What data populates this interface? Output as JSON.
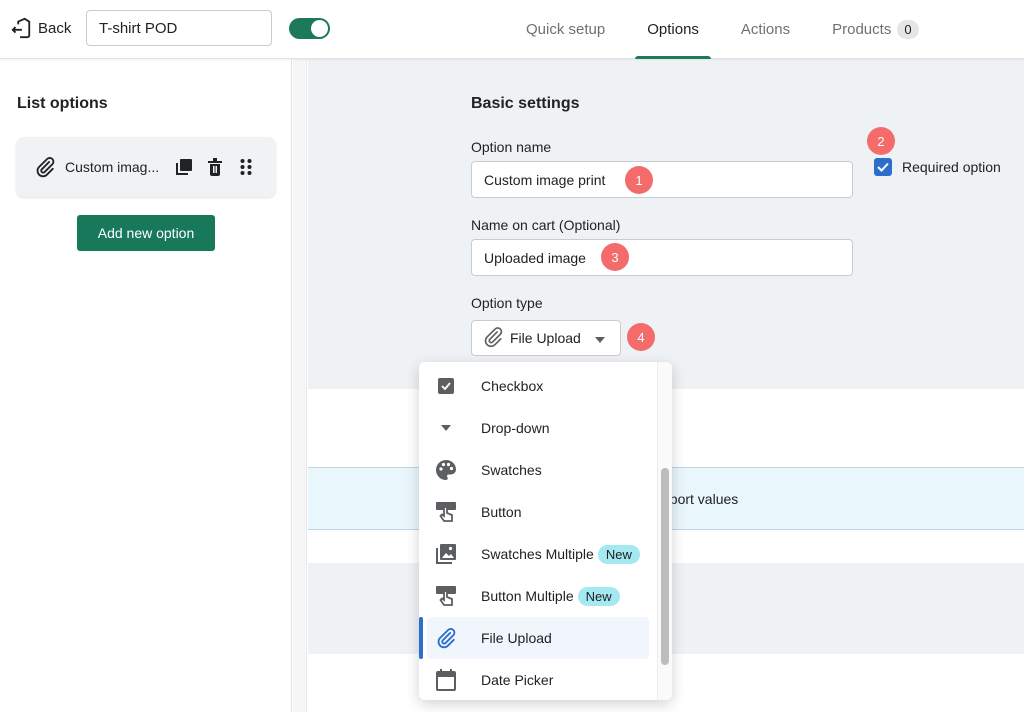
{
  "header": {
    "back_label": "Back",
    "title_value": "T-shirt POD",
    "toggle_on": true,
    "tabs": [
      {
        "label": "Quick setup",
        "active": false
      },
      {
        "label": "Options",
        "active": true
      },
      {
        "label": "Actions",
        "active": false
      },
      {
        "label": "Products",
        "active": false,
        "count": "0"
      }
    ]
  },
  "sidebar": {
    "title": "List options",
    "options": [
      {
        "label": "Custom imag...",
        "icon": "paperclip-icon"
      }
    ],
    "add_button": "Add new option"
  },
  "main": {
    "section_title": "Basic settings",
    "option_name_label": "Option name",
    "option_name_value": "Custom image print",
    "required_label": "Required option",
    "required_checked": true,
    "cart_label": "Name on cart (Optional)",
    "cart_value": "Uploaded image",
    "type_label": "Option type",
    "type_value": "File Upload",
    "info_text": "pport values",
    "markers": [
      "1",
      "2",
      "3",
      "4"
    ]
  },
  "dropdown": {
    "items": [
      {
        "label": "Checkbox",
        "icon": "checkbox-icon"
      },
      {
        "label": "Drop-down",
        "icon": "caret-down-icon"
      },
      {
        "label": "Swatches",
        "icon": "palette-icon"
      },
      {
        "label": "Button",
        "icon": "button-click-icon"
      },
      {
        "label": "Swatches Multiple",
        "icon": "images-icon",
        "badge": "New"
      },
      {
        "label": "Button Multiple",
        "icon": "button-click-icon",
        "badge": "New"
      },
      {
        "label": "File Upload",
        "icon": "paperclip-icon",
        "selected": true
      },
      {
        "label": "Date Picker",
        "icon": "calendar-icon"
      }
    ]
  },
  "colors": {
    "brand_green": "#18785a",
    "marker_red": "#f36b6b",
    "accent_blue": "#2c6ecb",
    "new_badge": "#a4e8f2"
  }
}
